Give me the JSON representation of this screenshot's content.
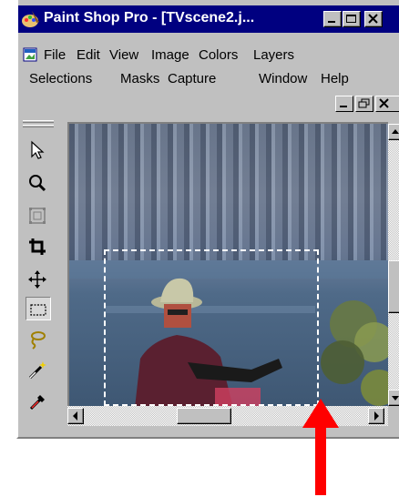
{
  "window": {
    "title": "Paint Shop Pro - [TVscene2.j...",
    "controls": [
      "minimize-icon",
      "maximize-icon",
      "close-icon"
    ]
  },
  "menu": {
    "row1": [
      "File",
      "Edit",
      "View",
      "Image",
      "Colors",
      "Layers"
    ],
    "row2": [
      "Selections",
      "Masks",
      "Capture",
      "Window",
      "Help"
    ]
  },
  "mdi_controls": [
    "minimize-icon",
    "restore-icon",
    "close-icon"
  ],
  "toolbox": {
    "tools": [
      "arrow-icon",
      "zoom-icon",
      "deformation-icon",
      "crop-icon",
      "mover-icon",
      "selection-rectangle-icon",
      "freehand-lasso-icon",
      "magic-wand-icon",
      "dropper-icon"
    ],
    "active_tool": "selection-rectangle-icon"
  },
  "colors": {
    "titlebar": "#000080",
    "chrome": "#c0c0c0",
    "annotation_arrow": "#ff0000",
    "selection_marquee": "#ffffff"
  },
  "scrollbars": {
    "vertical_thumb_position": 0.55,
    "horizontal_thumb_position": 0.18
  }
}
